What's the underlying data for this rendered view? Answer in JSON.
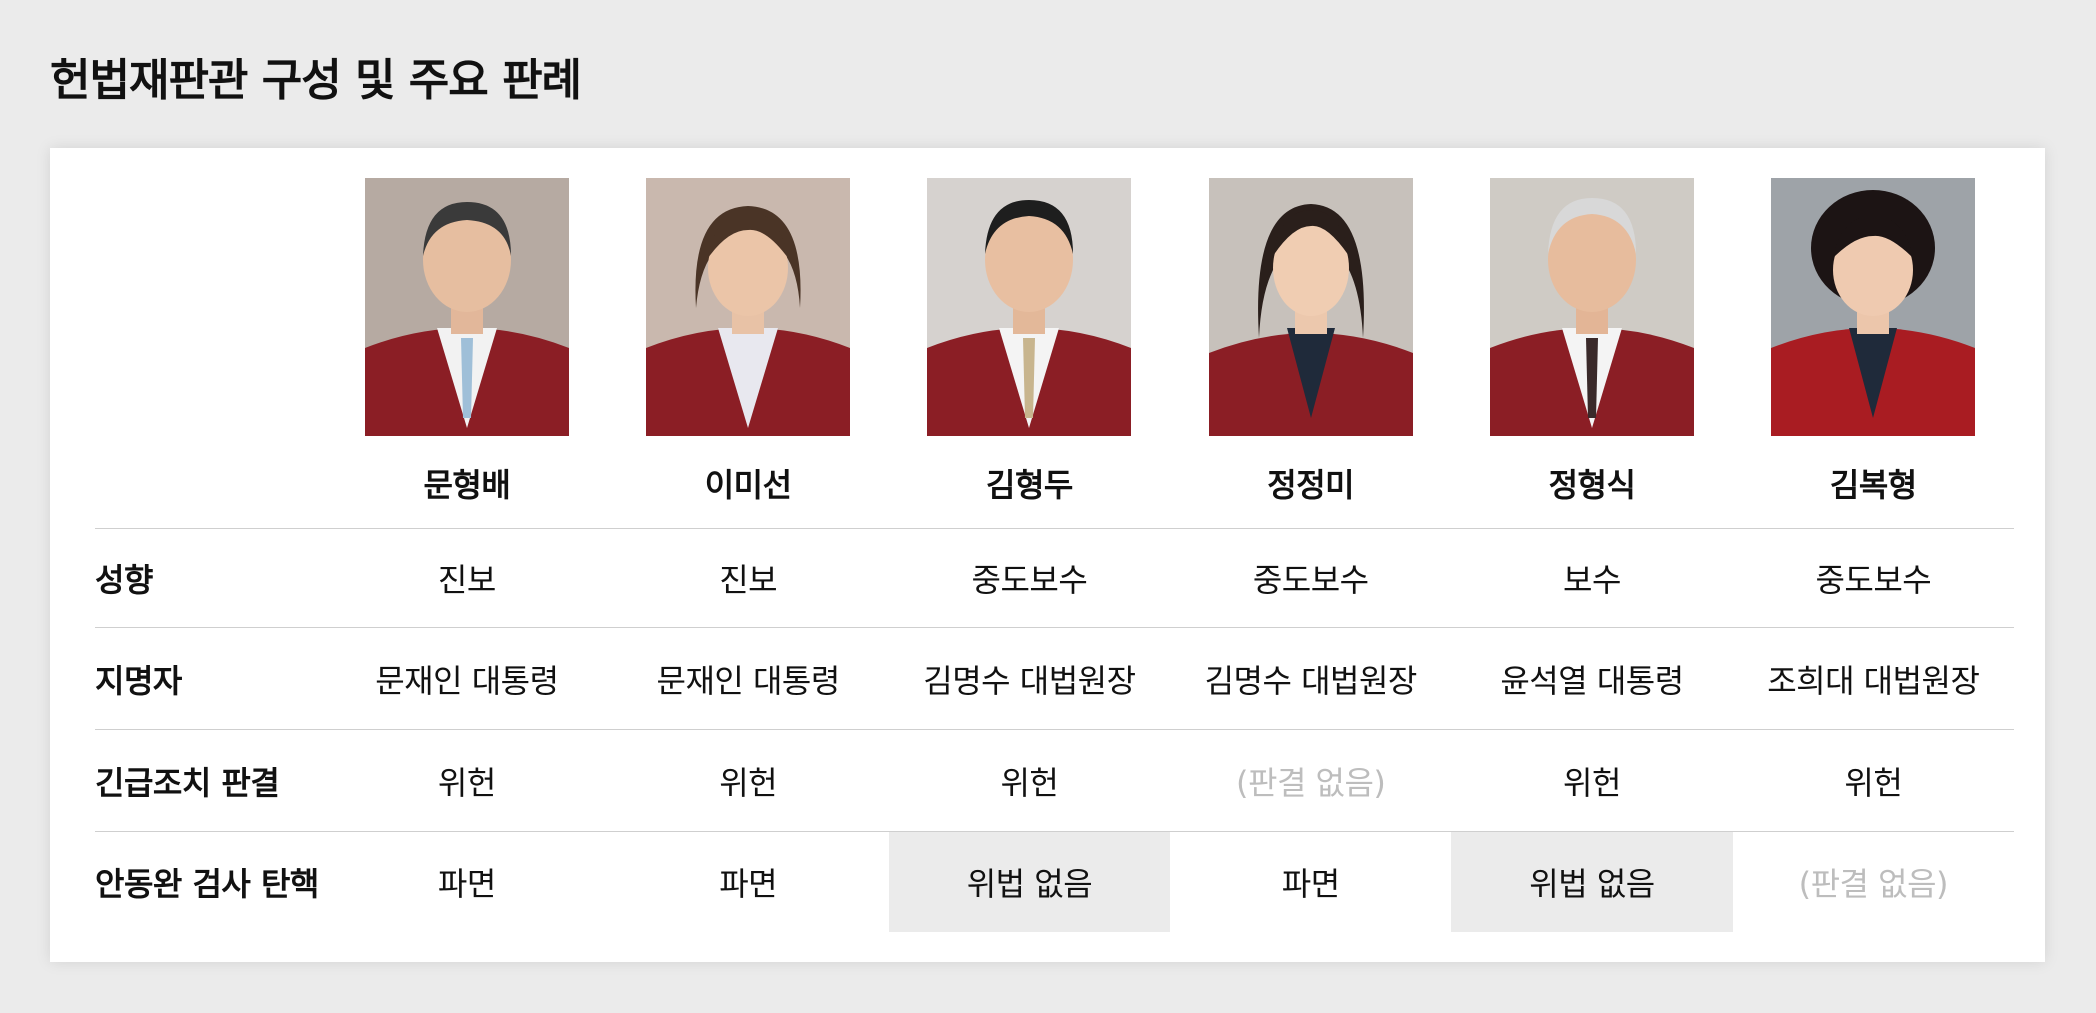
{
  "title": "헌법재판관 구성 및 주요 판례",
  "colors": {
    "page_background": "#ebebeb",
    "card_background": "#ffffff",
    "shaded_cell": "#ebebeb",
    "muted_text": "#bdbdbd",
    "robe": "#8b1e25"
  },
  "judges": [
    {
      "name": "문형배",
      "photo_icon": "judge-portrait-icon"
    },
    {
      "name": "이미선",
      "photo_icon": "judge-portrait-icon"
    },
    {
      "name": "김형두",
      "photo_icon": "judge-portrait-icon"
    },
    {
      "name": "정정미",
      "photo_icon": "judge-portrait-icon"
    },
    {
      "name": "정형식",
      "photo_icon": "judge-portrait-icon"
    },
    {
      "name": "김복형",
      "photo_icon": "judge-portrait-icon"
    }
  ],
  "rows": [
    {
      "label": "성향",
      "values": [
        "진보",
        "진보",
        "중도보수",
        "중도보수",
        "보수",
        "중도보수"
      ]
    },
    {
      "label": "지명자",
      "values": [
        "문재인 대통령",
        "문재인 대통령",
        "김명수 대법원장",
        "김명수 대법원장",
        "윤석열 대통령",
        "조희대 대법원장"
      ]
    },
    {
      "label": "긴급조치 판결",
      "values": [
        "위헌",
        "위헌",
        "위헌",
        "(판결 없음)",
        "위헌",
        "위헌"
      ]
    },
    {
      "label": "안동완 검사 탄핵",
      "values": [
        "파면",
        "파면",
        "위법 없음",
        "파면",
        "위법 없음",
        "(판결 없음)"
      ]
    }
  ]
}
